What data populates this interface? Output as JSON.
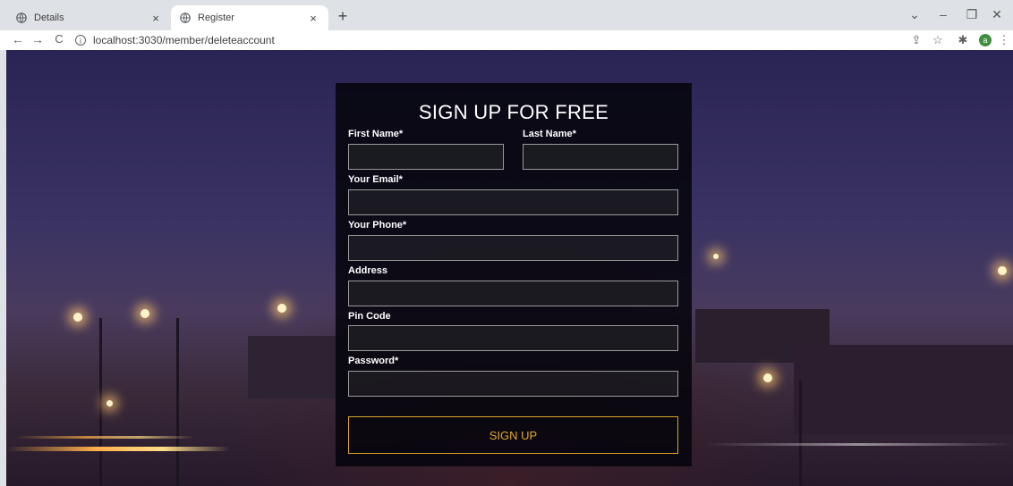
{
  "browser": {
    "tabs": [
      {
        "label": "Details",
        "close": "×"
      },
      {
        "label": "Register",
        "close": "×"
      }
    ],
    "new_tab": "+",
    "window_controls": {
      "dropdown": "⌄",
      "minimize": "–",
      "restore": "❐",
      "close": "✕"
    },
    "nav": {
      "back": "←",
      "forward": "→",
      "reload": "C"
    },
    "address": "localhost:3030/member/deleteaccount",
    "address_info_icon": "i",
    "toolbar_icons": {
      "share": "⇪",
      "bookmark": "☆",
      "extensions": "✱"
    },
    "profile_initial": "a"
  },
  "form": {
    "title": "SIGN UP FOR FREE",
    "first_name_label": "First Name*",
    "last_name_label": "Last Name*",
    "email_label": "Your Email*",
    "phone_label": "Your Phone*",
    "address_label": "Address",
    "pin_label": "Pin Code",
    "password_label": "Password*",
    "submit_label": "SIGN UP",
    "first_name_value": "",
    "last_name_value": "",
    "email_value": "",
    "phone_value": "",
    "address_value": "",
    "pin_value": "",
    "password_value": ""
  },
  "colors": {
    "accent_gold": "#d8a52a",
    "form_bg": "#06040c",
    "tabstrip": "#dee1e6",
    "profile": "#3f8f3f"
  }
}
